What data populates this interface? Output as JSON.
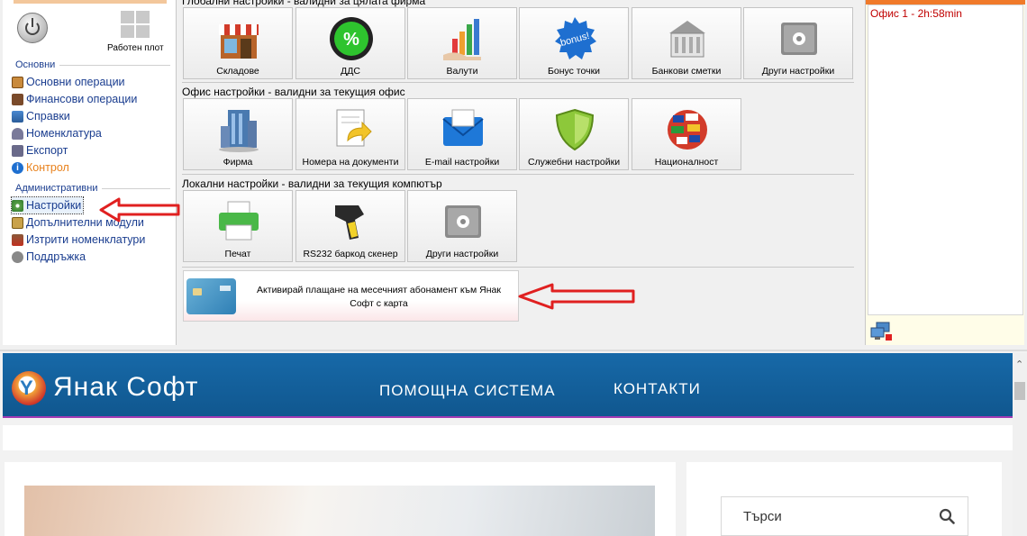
{
  "app": {
    "left_panel": {
      "desktop_label": "Работен плот",
      "groups": [
        {
          "title": "Основни"
        },
        {
          "title": "Административни"
        }
      ],
      "items": [
        {
          "label": "Основни операции",
          "color": "#1a3d8f",
          "icon": "clipboard-icon"
        },
        {
          "label": "Финансови операции",
          "color": "#1a3d8f",
          "icon": "finance-icon"
        },
        {
          "label": "Справки",
          "color": "#1a3d8f",
          "icon": "reports-icon"
        },
        {
          "label": "Номенклатура",
          "color": "#1a3d8f",
          "icon": "nomenclature-icon"
        },
        {
          "label": "Експорт",
          "color": "#1a3d8f",
          "icon": "export-icon"
        },
        {
          "label": "Контрол",
          "color": "#e8801a",
          "icon": "info-icon"
        },
        {
          "label": "Настройки",
          "color": "#1a3d8f",
          "icon": "settings-icon",
          "selected": true
        },
        {
          "label": "Допълнителни модули",
          "color": "#1a3d8f",
          "icon": "modules-icon"
        },
        {
          "label": "Изтрити номенклатури",
          "color": "#1a3d8f",
          "icon": "deleted-icon"
        },
        {
          "label": "Поддръжка",
          "color": "#1a3d8f",
          "icon": "support-icon"
        }
      ]
    },
    "sections": [
      {
        "title": "Глобални настройки - валидни за цялата фирма",
        "tiles": [
          {
            "label": "Складове",
            "icon": "store-icon"
          },
          {
            "label": "ДДС",
            "icon": "vat-percent-icon"
          },
          {
            "label": "Валути",
            "icon": "currency-chart-icon"
          },
          {
            "label": "Бонус точки",
            "icon": "bonus-icon"
          },
          {
            "label": "Банкови сметки",
            "icon": "bank-icon"
          },
          {
            "label": "Други настройки",
            "icon": "settings-box-icon"
          }
        ]
      },
      {
        "title": "Офис настройки - валидни за текущия офис",
        "tiles": [
          {
            "label": "Фирма",
            "icon": "building-icon"
          },
          {
            "label": "Номера на документи",
            "icon": "document-icon"
          },
          {
            "label": "E-mail настройки",
            "icon": "envelope-icon"
          },
          {
            "label": "Служебни настройки",
            "icon": "shield-icon"
          },
          {
            "label": "Националност",
            "icon": "globe-flags-icon"
          }
        ]
      },
      {
        "title": "Локални настройки - валидни за текущия компютър",
        "tiles": [
          {
            "label": "Печат",
            "icon": "printer-icon"
          },
          {
            "label": "RS232 баркод скенер",
            "icon": "barcode-scanner-icon"
          },
          {
            "label": "Други настройки",
            "icon": "settings-box-icon"
          }
        ]
      }
    ],
    "card_tile": {
      "text": "Активирай плащане на месечният абонамент към Янак Софт с карта",
      "icon": "credit-card-icon"
    },
    "right_panel": {
      "entries": [
        "Офис 1 - 2h:58min"
      ]
    },
    "colors": {
      "accent_orange": "#f07a2a",
      "annotation_red": "#e02020",
      "web_nav_blue": "#1769a8"
    }
  },
  "website": {
    "logo_text": "Янак Софт",
    "nav": [
      "ПОМОЩНА СИСТЕМА",
      "КОНТАКТИ"
    ],
    "search": {
      "placeholder": "Търси"
    }
  }
}
